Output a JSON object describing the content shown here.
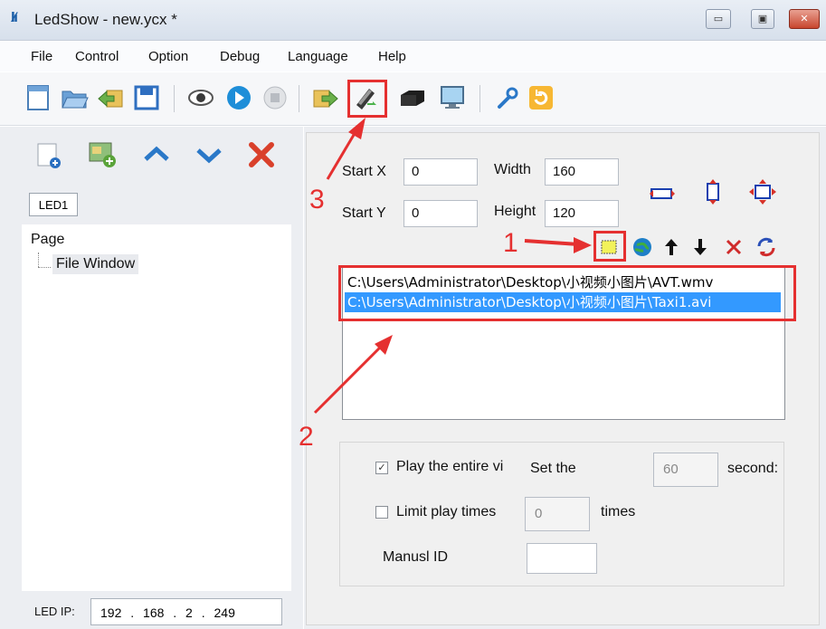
{
  "window": {
    "title": "LedShow - new.ycx *",
    "minimize": "▭",
    "maximize": "▣",
    "close": "✕"
  },
  "menu": [
    "File",
    "Control",
    "Option",
    "Debug",
    "Language",
    "Help"
  ],
  "toolbar": {
    "icons": [
      "new-icon",
      "open-icon",
      "import-icon",
      "save-icon",
      "preview-icon",
      "play-icon",
      "stop-icon",
      "export-icon",
      "send-usb-icon",
      "device-icon",
      "monitor-icon",
      "settings-wrench-icon",
      "refresh-icon"
    ]
  },
  "left": {
    "led_tab": "LED1",
    "tree": {
      "root": "Page",
      "child": "File Window"
    },
    "led_ip_label": "LED IP:",
    "led_ip_value": "192 . 168 . 2 . 249"
  },
  "right": {
    "start_x_label": "Start X",
    "start_x_value": "0",
    "width_label": "Width",
    "width_value": "160",
    "start_y_label": "Start Y",
    "start_y_value": "0",
    "height_label": "Height",
    "height_value": "120",
    "files": [
      "C:\\Users\\Administrator\\Desktop\\小视频小图片\\AVT.wmv",
      "C:\\Users\\Administrator\\Desktop\\小视频小图片\\Taxi1.avi"
    ],
    "play_entire_label": "Play the entire vi",
    "set_the_label": "Set the",
    "seconds_value": "60",
    "seconds_label": "second:",
    "limit_play_label": "Limit play times",
    "times_value": "0",
    "times_label": "times",
    "manual_id_label": "Manusl ID",
    "manual_id_value": ""
  },
  "annotations": [
    "1",
    "2",
    "3"
  ],
  "colors": {
    "selection": "#3399ff",
    "annotation": "#e53030"
  }
}
